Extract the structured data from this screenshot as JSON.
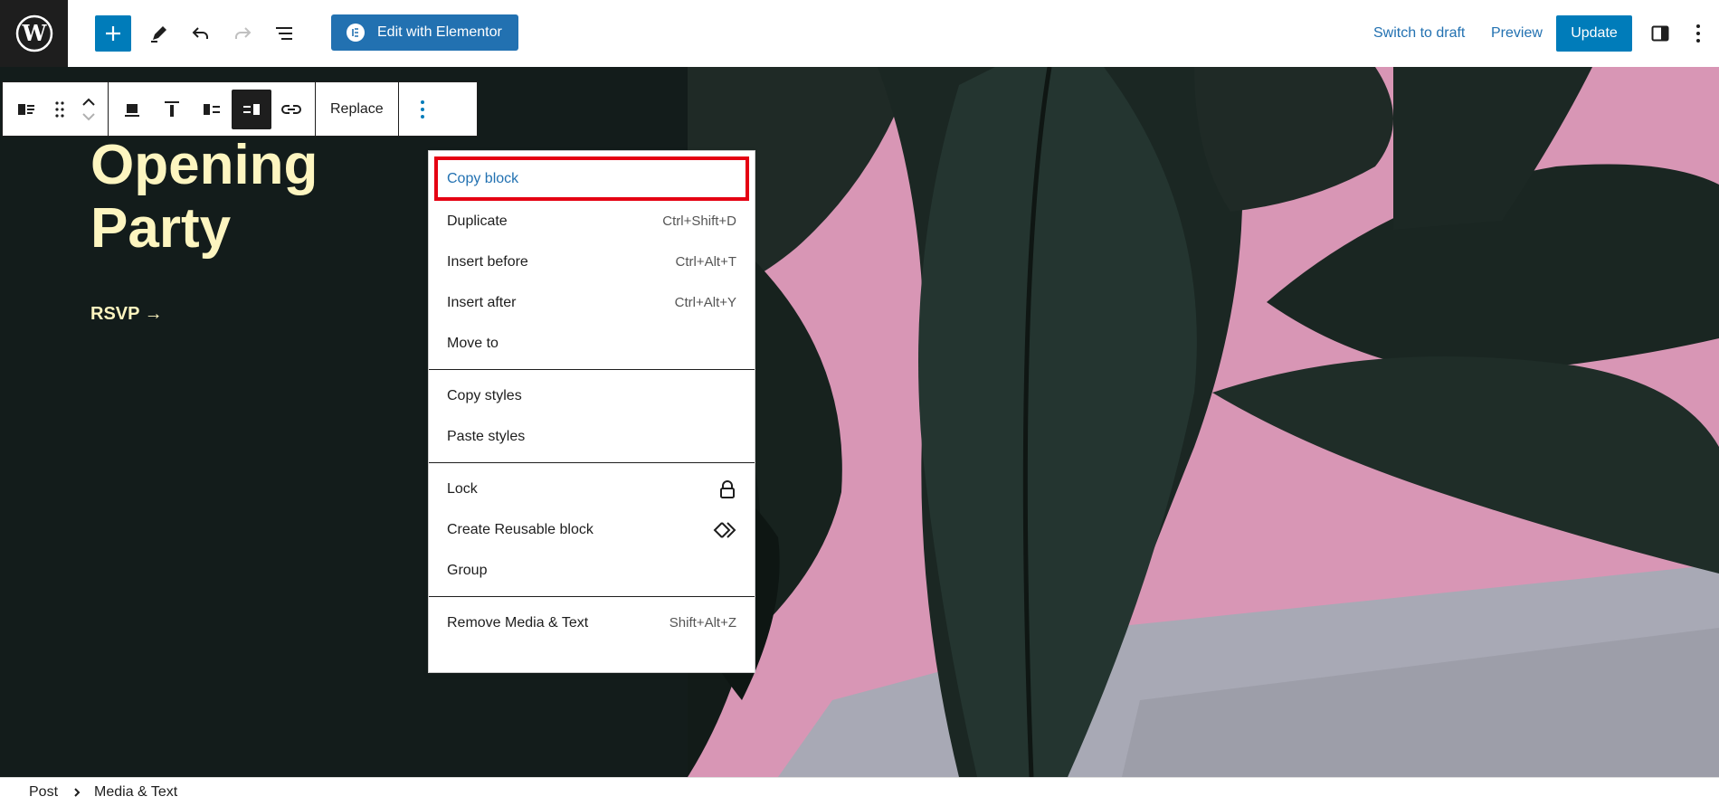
{
  "header": {
    "elementor_label": "Edit with Elementor",
    "switch_to_draft": "Switch to draft",
    "preview": "Preview",
    "update": "Update"
  },
  "content": {
    "title_line1": "Opening",
    "title_line2": "Party",
    "rsvp": "RSVP →"
  },
  "block_toolbar": {
    "replace_label": "Replace"
  },
  "context_menu": {
    "sections": [
      [
        {
          "label": "Copy block",
          "shortcut": ""
        },
        {
          "label": "Duplicate",
          "shortcut": "Ctrl+Shift+D"
        },
        {
          "label": "Insert before",
          "shortcut": "Ctrl+Alt+T"
        },
        {
          "label": "Insert after",
          "shortcut": "Ctrl+Alt+Y"
        },
        {
          "label": "Move to",
          "shortcut": ""
        }
      ],
      [
        {
          "label": "Copy styles",
          "shortcut": ""
        },
        {
          "label": "Paste styles",
          "shortcut": ""
        }
      ],
      [
        {
          "label": "Lock",
          "icon": "lock-icon"
        },
        {
          "label": "Create Reusable block",
          "icon": "reusable-block-icon"
        },
        {
          "label": "Group",
          "shortcut": ""
        }
      ],
      [
        {
          "label": "Remove Media & Text",
          "shortcut": "Shift+Alt+Z"
        }
      ]
    ]
  },
  "footer": {
    "crumb_post": "Post",
    "crumb_block": "Media & Text"
  },
  "colors": {
    "accent": "#007cba",
    "dark_bg": "#131c1b",
    "title_yellow": "#fdf5c0",
    "highlight_border": "#e50012"
  }
}
